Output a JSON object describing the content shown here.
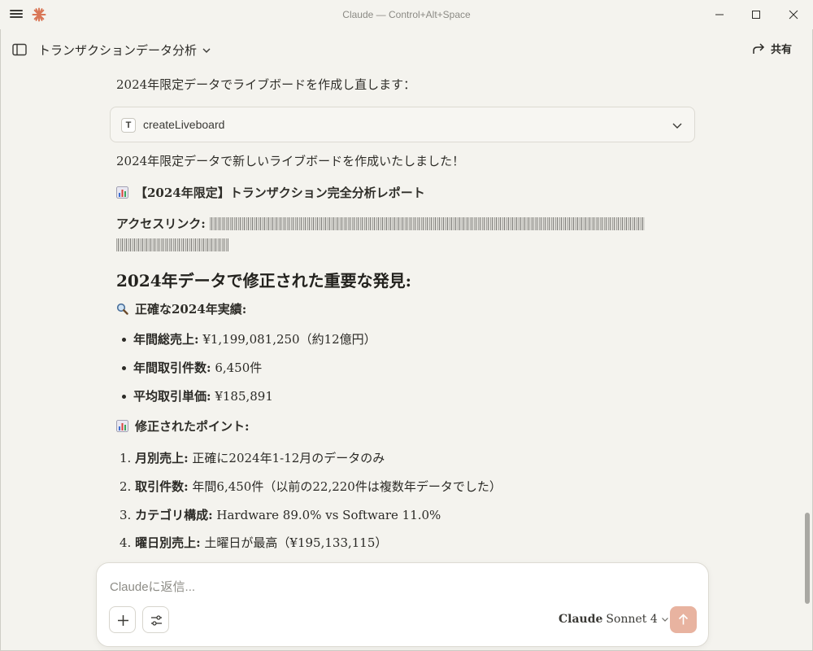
{
  "window": {
    "title": "Claude — Control+Alt+Space"
  },
  "chat": {
    "title": "トランザクションデータ分析",
    "share_label": "共有"
  },
  "messages": {
    "intro": "2024年限定データでライブボードを作成し直します：",
    "tool_call": "createLiveboard",
    "result": "2024年限定データで新しいライブボードを作成いたしました！",
    "report_title": "【2024年限定】トランザクション完全分析レポート",
    "access_label": "アクセスリンク:",
    "section_heading": "2024年データで修正された重要な発見:",
    "accurate_heading": "正確な2024年実績:",
    "bullets": [
      {
        "label": "年間総売上:",
        "value": " ¥1,199,081,250（約12億円）"
      },
      {
        "label": "年間取引件数:",
        "value": " 6,450件"
      },
      {
        "label": "平均取引単価:",
        "value": " ¥185,891"
      }
    ],
    "points_heading": "修正されたポイント:",
    "numbered": [
      {
        "num": "1.",
        "label": "月別売上:",
        "value": " 正確に2024年1-12月のデータのみ"
      },
      {
        "num": "2.",
        "label": "取引件数:",
        "value": " 年間6,450件（以前の22,220件は複数年データでした）"
      },
      {
        "num": "3.",
        "label": "カテゴリ構成:",
        "value": " Hardware 89.0% vs Software 11.0%"
      },
      {
        "num": "4.",
        "label": "曜日別売上:",
        "value": " 土曜日が最高（¥195,133,115）"
      }
    ]
  },
  "composer": {
    "placeholder": "Claudeに返信...",
    "model_brand": "Claude",
    "model_name": "Sonnet 4"
  },
  "icons": {
    "logo": "claude-logo-icon",
    "menu": "hamburger-icon",
    "sidebar": "sidebar-toggle-icon",
    "share": "share-arrow-icon",
    "chart": "bar-chart-emoji-icon",
    "magnifier": "magnifying-glass-emoji-icon"
  },
  "colors": {
    "background": "#f4f3ee",
    "accent": "#d97757",
    "send_button": "#e8b3a0"
  }
}
